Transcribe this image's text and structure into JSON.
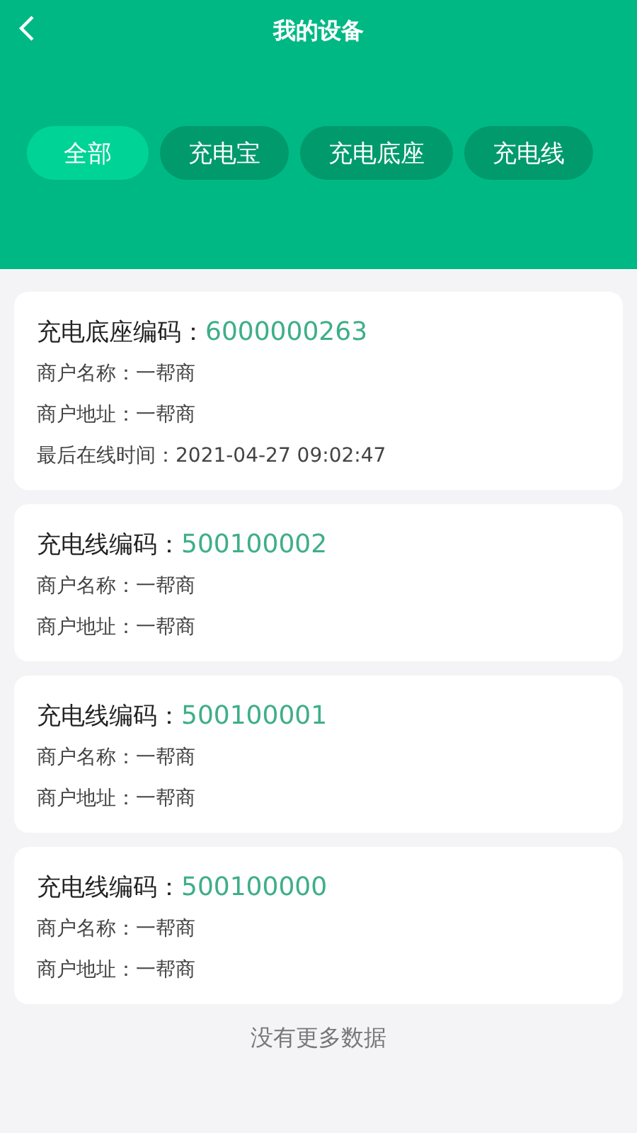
{
  "header": {
    "title": "我的设备"
  },
  "tabs": [
    {
      "label": "全部",
      "selected": true
    },
    {
      "label": "充电宝",
      "selected": false
    },
    {
      "label": "充电底座",
      "selected": false
    },
    {
      "label": "充电线",
      "selected": false
    }
  ],
  "devices": [
    {
      "code_label": "充电底座编码：",
      "code": "6000000263",
      "lines": [
        "商户名称：一帮商",
        "商户地址：一帮商",
        "最后在线时间：2021-04-27 09:02:47"
      ]
    },
    {
      "code_label": "充电线编码：",
      "code": "500100002",
      "lines": [
        "商户名称：一帮商",
        "商户地址：一帮商"
      ]
    },
    {
      "code_label": "充电线编码：",
      "code": "500100001",
      "lines": [
        "商户名称：一帮商",
        "商户地址：一帮商"
      ]
    },
    {
      "code_label": "充电线编码：",
      "code": "500100000",
      "lines": [
        "商户名称：一帮商",
        "商户地址：一帮商"
      ]
    }
  ],
  "footer": "没有更多数据"
}
